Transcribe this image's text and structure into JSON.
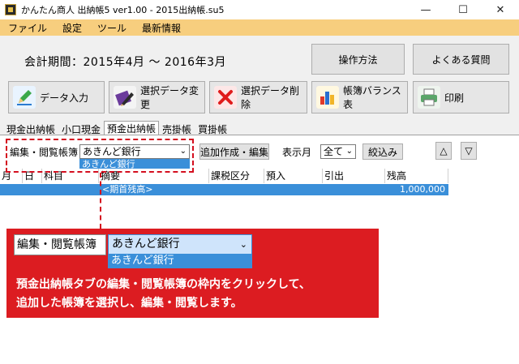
{
  "window": {
    "title": "かんたん商人 出納帳5 ver1.00 - 2015出納帳.su5",
    "minimize": "—",
    "maximize": "☐",
    "close": "✕"
  },
  "menu": [
    "ファイル",
    "設定",
    "ツール",
    "最新情報"
  ],
  "period": "会計期間：2015年4月 〜 2016年3月",
  "top_buttons": {
    "help": "操作方法",
    "faq": "よくある質問"
  },
  "toolbar": {
    "data_entry": "データ入力",
    "change_selected": "選択データ変更",
    "delete_selected": "選択データ削除",
    "balance_sheet": "帳簿バランス表",
    "print": "印刷"
  },
  "tabs": [
    "現金出納帳",
    "小口現金",
    "預金出納帳",
    "売掛帳",
    "買掛帳"
  ],
  "filter": {
    "book_label": "編集・閲覧帳簿",
    "book_value": "あきんど銀行",
    "book_option": "あきんど銀行",
    "add_edit_button": "追加作成・編集",
    "month_label": "表示月",
    "month_value": "全て",
    "filter_button": "絞込み",
    "up": "△",
    "down": "▽"
  },
  "grid": {
    "headers": [
      "月",
      "日",
      "科目",
      "摘要",
      "課税区分",
      "預入",
      "引出",
      "残高"
    ],
    "row": {
      "memo": "<期首残高>",
      "balance": "1,000,000"
    }
  },
  "callout": {
    "label": "編集・閲覧帳簿",
    "value": "あきんど銀行",
    "option": "あきんど銀行",
    "line1": "預金出納帳タブの編集・閲覧帳簿の枠内をクリックして、",
    "line2": "追加した帳簿を選択し、編集・閲覧します。"
  },
  "colors": {
    "accent": "#dc1c21",
    "selection": "#3a8fd9",
    "menubar": "#f7ce7e"
  }
}
